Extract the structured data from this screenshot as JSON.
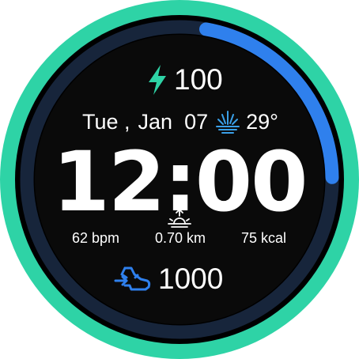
{
  "colors": {
    "bezel": "#2ed3a6",
    "face": "#0a0a0a",
    "track": "#17253b",
    "progress": "#2f80ed",
    "bolt": "#2ed3a6",
    "weather": "#3aa0e8",
    "steps_icon": "#2f80ed"
  },
  "battery": {
    "icon": "lightning-bolt-icon",
    "value": "100",
    "level": 1.0
  },
  "progress_arc": {
    "fraction": 0.22
  },
  "date": {
    "weekday": "Tue ,",
    "month_day": "Jan  07",
    "weather_icon": "hot-weather-icon",
    "temperature": "29°"
  },
  "time": {
    "value": "12:00"
  },
  "sunrise_icon": "sunrise-icon",
  "stats": {
    "heart_rate": "62 bpm",
    "distance": "0.70 km",
    "calories": "75 kcal"
  },
  "steps": {
    "icon": "running-shoe-icon",
    "value": "1000"
  }
}
